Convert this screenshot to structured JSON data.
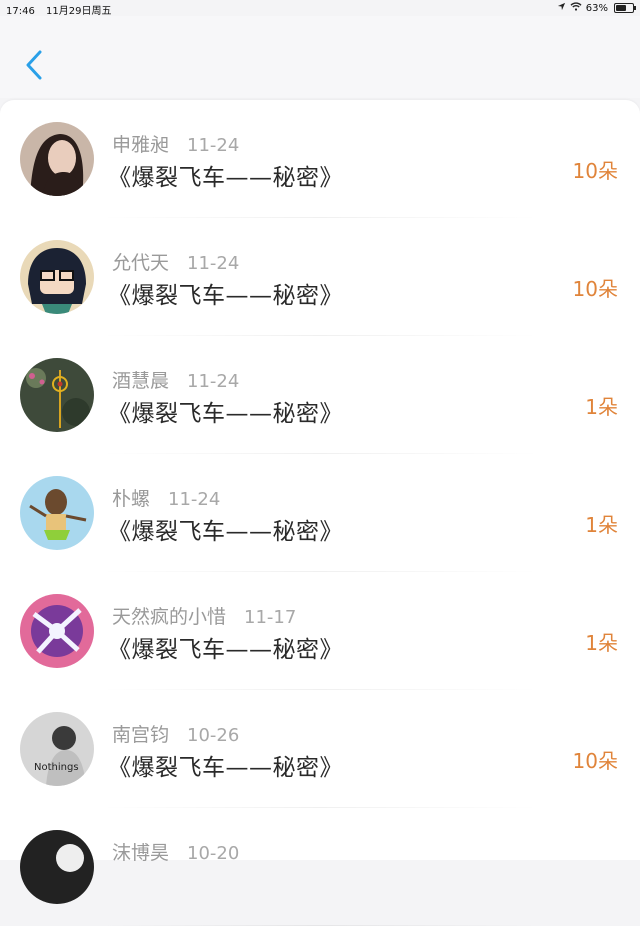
{
  "status_bar": {
    "time": "17:46",
    "date": "11月29日周五",
    "battery": "63%",
    "icons": [
      "location-icon",
      "wifi-icon",
      "battery-icon"
    ]
  },
  "nav": {
    "back_icon": "chevron-left-icon"
  },
  "colors": {
    "accent": "#2aa0e8",
    "flowers": "#e0843a",
    "muted": "#9a9a9a"
  },
  "items": [
    {
      "name": "申雅昶",
      "date": "11-24",
      "title": "《爆裂飞车——秘密》",
      "flowers": "10朵"
    },
    {
      "name": "允代天",
      "date": "11-24",
      "title": "《爆裂飞车——秘密》",
      "flowers": "10朵"
    },
    {
      "name": "酒慧晨",
      "date": "11-24",
      "title": "《爆裂飞车——秘密》",
      "flowers": "1朵"
    },
    {
      "name": "朴螺",
      "date": "11-24",
      "title": "《爆裂飞车——秘密》",
      "flowers": "1朵"
    },
    {
      "name": "天然疯的小惜",
      "date": "11-17",
      "title": "《爆裂飞车——秘密》",
      "flowers": "1朵"
    },
    {
      "name": "南宫钧",
      "date": "10-26",
      "title": "《爆裂飞车——秘密》",
      "flowers": "10朵",
      "avatar_text": "Nothings"
    },
    {
      "name": "沫博昊",
      "date": "10-20",
      "title": "",
      "flowers": ""
    }
  ]
}
